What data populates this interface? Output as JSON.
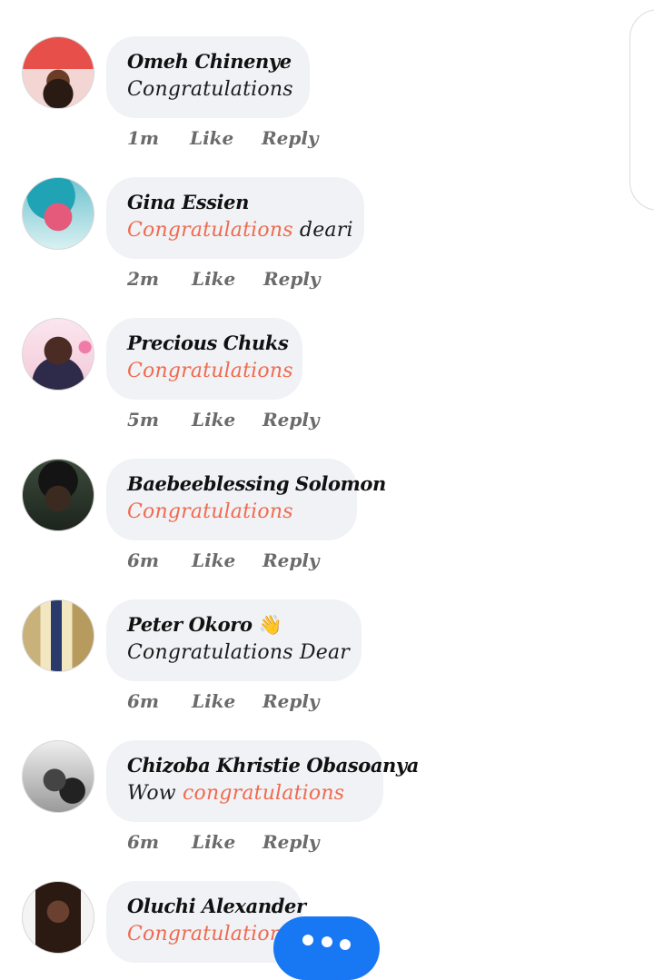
{
  "comments": [
    {
      "name": "Omeh Chinenye",
      "text_before": "",
      "text_highlight": "",
      "text_after": "Congratulations",
      "time": "1m",
      "like": "Like",
      "reply": "Reply"
    },
    {
      "name": "Gina Essien",
      "text_before": "",
      "text_highlight": "Congratulations",
      "text_after": " deari",
      "time": "2m",
      "like": "Like",
      "reply": "Reply"
    },
    {
      "name": "Precious Chuks",
      "text_before": "",
      "text_highlight": "Congratulations",
      "text_after": "",
      "time": "5m",
      "like": "Like",
      "reply": "Reply"
    },
    {
      "name": "Baebeeblessing Solomon",
      "text_before": "",
      "text_highlight": "Congratulations",
      "text_after": "",
      "time": "6m",
      "like": "Like",
      "reply": "Reply"
    },
    {
      "name": "Peter Okoro",
      "name_emoji": "👋",
      "text_before": "",
      "text_highlight": "",
      "text_after": "Congratulations Dear",
      "time": "6m",
      "like": "Like",
      "reply": "Reply"
    },
    {
      "name": "Chizoba Khristie Obasoanya",
      "text_before": "Wow ",
      "text_highlight": "congratulations",
      "text_after": "",
      "time": "6m",
      "like": "Like",
      "reply": "Reply"
    },
    {
      "name": "Oluchi Alexander",
      "text_before": "",
      "text_highlight": "Congratulations",
      "text_after": "",
      "time": "",
      "like": "",
      "reply": ""
    }
  ],
  "colors": {
    "highlight": "#f06a4f",
    "bubble": "#f0f2f5",
    "accent": "#1877f2"
  },
  "icons": {
    "more_button": "ellipsis-icon"
  }
}
